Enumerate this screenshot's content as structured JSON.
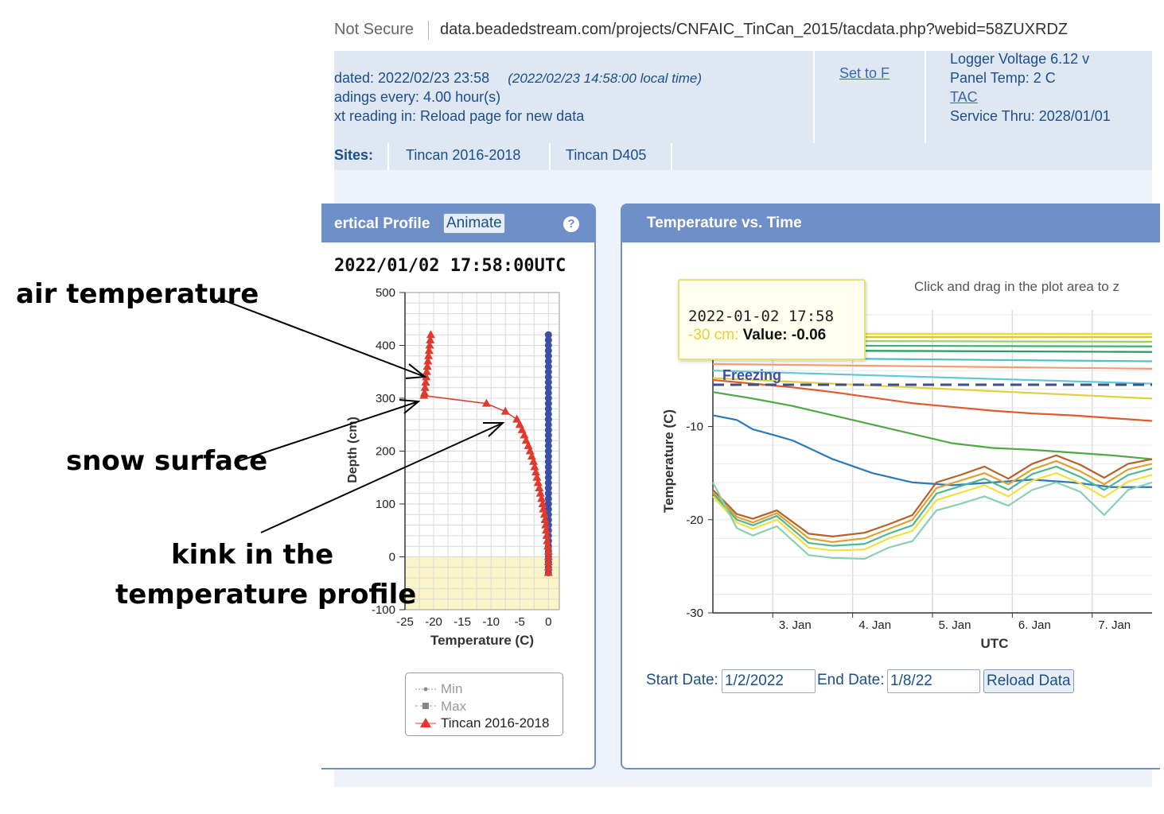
{
  "address_bar": {
    "security": "Not Secure",
    "url": "data.beadedstream.com/projects/CNFAIC_TinCan_2015/tacdata.php?webid=58ZUXRDZ"
  },
  "header": {
    "updated": "dated: 2022/02/23 23:58",
    "local_time": "(2022/02/23 14:58:00 local time)",
    "readings": "adings every: 4.00 hour(s)",
    "next_reading": "xt reading in: Reload page for new data",
    "set_to_f": "Set to F",
    "logger_voltage": "Logger Voltage 6.12 v",
    "panel_temp": "Panel Temp: 2 C",
    "tac_link": "TAC",
    "service_thru": "Service Thru: 2028/01/01"
  },
  "sites": {
    "label": "Sites:",
    "items": [
      "Tincan 2016-2018",
      "Tincan D405"
    ]
  },
  "vertical_profile": {
    "title": "ertical Profile",
    "animate_button": "Animate",
    "help_icon": "?",
    "timestamp": "2022/01/02 17:58:00UTC",
    "legend": [
      "Min",
      "Max",
      "Tincan 2016-2018"
    ]
  },
  "temp_vs_time": {
    "title": "Temperature vs. Time",
    "hint": "Click and drag in the plot area to z",
    "tooltip_date": "2022-01-02 17:58",
    "tooltip_series": "-30 cm:",
    "tooltip_value": "Value: -0.06",
    "freezing_label": "Freezing",
    "start_label": "Start Date:",
    "start_value": "1/2/2022",
    "end_label": "End Date:",
    "end_value": "1/8/22",
    "reload_button": "Reload Data"
  },
  "annotations": {
    "air": "air temperature",
    "snow": "snow surface",
    "kink_line1": "kink in the",
    "kink_line2": "temperature profile"
  },
  "colors": {
    "panel_blue": "#6f8fc8",
    "header_bg": "#dfe7f3",
    "link_blue": "#1a4f8a",
    "profile_red": "#e03a2f",
    "profile_blue": "#3b4fa8",
    "ground_yellow": "#faf5c8"
  },
  "chart_data": [
    {
      "type": "scatter",
      "xlabel": "Temperature (C)",
      "ylabel": "Depth (cm)",
      "xlim": [
        -25,
        0
      ],
      "ylim": [
        -100,
        500
      ],
      "x_ticks": [
        -25,
        -20,
        -15,
        -10,
        -5,
        0
      ],
      "y_ticks": [
        -100,
        0,
        100,
        200,
        300,
        400,
        500
      ],
      "grid": true,
      "legend_position": "bottom",
      "series": [
        {
          "name": "Tincan 2016-2018",
          "points": [
            [
              -20.5,
              420
            ],
            [
              -20.6,
              410
            ],
            [
              -20.7,
              400
            ],
            [
              -20.8,
              390
            ],
            [
              -20.9,
              380
            ],
            [
              -21.0,
              370
            ],
            [
              -21.1,
              360
            ],
            [
              -21.2,
              350
            ],
            [
              -21.3,
              340
            ],
            [
              -21.4,
              330
            ],
            [
              -21.5,
              320
            ],
            [
              -21.6,
              310
            ],
            [
              -21.7,
              305
            ],
            [
              -10.8,
              290
            ],
            [
              -7.5,
              275
            ],
            [
              -5.5,
              260
            ],
            [
              -5.0,
              250
            ],
            [
              -4.6,
              240
            ],
            [
              -4.2,
              230
            ],
            [
              -3.9,
              220
            ],
            [
              -3.5,
              210
            ],
            [
              -3.2,
              200
            ],
            [
              -2.9,
              190
            ],
            [
              -2.6,
              180
            ],
            [
              -2.4,
              170
            ],
            [
              -2.2,
              160
            ],
            [
              -2.0,
              150
            ],
            [
              -1.8,
              140
            ],
            [
              -1.6,
              130
            ],
            [
              -1.4,
              120
            ],
            [
              -1.2,
              110
            ],
            [
              -1.0,
              100
            ],
            [
              -0.9,
              90
            ],
            [
              -0.7,
              80
            ],
            [
              -0.6,
              70
            ],
            [
              -0.5,
              60
            ],
            [
              -0.4,
              50
            ],
            [
              -0.3,
              40
            ],
            [
              -0.2,
              30
            ],
            [
              -0.1,
              20
            ],
            [
              0,
              10
            ],
            [
              0,
              0
            ],
            [
              0,
              -10
            ],
            [
              0,
              -20
            ],
            [
              0,
              -30
            ]
          ]
        },
        {
          "name": "",
          "points": [
            [
              0,
              420
            ],
            [
              0,
              410
            ],
            [
              0,
              400
            ],
            [
              0,
              390
            ],
            [
              0,
              380
            ],
            [
              0,
              370
            ],
            [
              0,
              360
            ],
            [
              0,
              350
            ],
            [
              0,
              340
            ],
            [
              0,
              330
            ],
            [
              0,
              320
            ],
            [
              0,
              310
            ],
            [
              0,
              300
            ],
            [
              0,
              290
            ],
            [
              0,
              280
            ],
            [
              0,
              270
            ],
            [
              0,
              260
            ],
            [
              0,
              250
            ],
            [
              0,
              240
            ],
            [
              0,
              230
            ],
            [
              0,
              220
            ],
            [
              0,
              210
            ],
            [
              0,
              200
            ],
            [
              0,
              190
            ],
            [
              0,
              180
            ],
            [
              0,
              170
            ],
            [
              0,
              160
            ],
            [
              0,
              150
            ],
            [
              0,
              140
            ],
            [
              0,
              130
            ],
            [
              0,
              120
            ],
            [
              0,
              110
            ],
            [
              0,
              100
            ],
            [
              0,
              90
            ],
            [
              0,
              80
            ],
            [
              0,
              70
            ],
            [
              0,
              60
            ],
            [
              0,
              50
            ],
            [
              0,
              40
            ],
            [
              0,
              30
            ],
            [
              0,
              20
            ],
            [
              0,
              10
            ],
            [
              0,
              0
            ],
            [
              0,
              -10
            ],
            [
              0,
              -20
            ],
            [
              0,
              -30
            ]
          ]
        }
      ]
    },
    {
      "type": "line",
      "xlabel": "UTC",
      "ylabel": "Temperature (C)",
      "x_ticks": [
        "3. Jan",
        "4. Jan",
        "5. Jan",
        "6. Jan",
        "7. Jan"
      ],
      "ylim": [
        -30,
        0
      ],
      "y_ticks": [
        -30,
        -20,
        -10,
        0
      ],
      "xlim_days": [
        2.0,
        7.5
      ],
      "series": [
        {
          "color": "#e8e020",
          "x": [
            2.0,
            7.5
          ],
          "values": [
            -0.06,
            -0.06
          ]
        },
        {
          "color": "#f0c020",
          "x": [
            2.0,
            7.5
          ],
          "values": [
            -0.4,
            -0.4
          ]
        },
        {
          "color": "#9fd060",
          "x": [
            2.0,
            7.5
          ],
          "values": [
            -0.8,
            -0.9
          ]
        },
        {
          "color": "#40b070",
          "x": [
            2.0,
            7.5
          ],
          "values": [
            -1.3,
            -1.4
          ]
        },
        {
          "color": "#2a9a60",
          "x": [
            2.0,
            7.5
          ],
          "values": [
            -1.8,
            -2.0
          ]
        },
        {
          "color": "#50c0c0",
          "x": [
            2.0,
            7.5
          ],
          "values": [
            -2.6,
            -3.0
          ]
        },
        {
          "color": "#f0a070",
          "x": [
            2.0,
            7.5
          ],
          "values": [
            -3.3,
            -3.8
          ]
        },
        {
          "color": "#60c8d8",
          "x": [
            2.0,
            7.5
          ],
          "values": [
            -4.0,
            -5.4
          ]
        },
        {
          "color": "#e0d040",
          "x": [
            2.0,
            7.5
          ],
          "values": [
            -4.8,
            -7.0
          ]
        },
        {
          "color": "#e05a30",
          "x": [
            2.0,
            2.5,
            3.0,
            3.5,
            4.0,
            4.5,
            5.0,
            5.5,
            6.0,
            6.5,
            7.0,
            7.5
          ],
          "values": [
            -5.0,
            -5.4,
            -5.8,
            -6.3,
            -6.9,
            -7.5,
            -7.9,
            -8.3,
            -8.6,
            -8.8,
            -9.1,
            -9.4
          ]
        },
        {
          "color": "#50a848",
          "x": [
            2.0,
            2.5,
            3.0,
            3.5,
            4.0,
            4.5,
            5.0,
            5.5,
            6.0,
            6.5,
            7.0,
            7.5
          ],
          "values": [
            -6.3,
            -7.0,
            -7.8,
            -8.8,
            -9.8,
            -10.8,
            -11.8,
            -12.3,
            -12.5,
            -12.8,
            -13.1,
            -13.5
          ]
        },
        {
          "color": "#2a7ab8",
          "x": [
            2.0,
            2.3,
            2.5,
            2.8,
            3.0,
            3.5,
            4.0,
            4.5,
            5.0,
            5.5,
            6.0,
            6.5,
            7.0,
            7.5
          ],
          "values": [
            -8.8,
            -9.3,
            -10.3,
            -11.0,
            -11.5,
            -13.5,
            -15.0,
            -16.0,
            -16.3,
            -16.0,
            -15.7,
            -16.0,
            -16.5,
            -16.5
          ]
        },
        {
          "color": "#b8602a",
          "x": [
            2.0,
            2.3,
            2.5,
            2.8,
            3.2,
            3.5,
            3.9,
            4.2,
            4.5,
            4.8,
            5.1,
            5.4,
            5.7,
            6.0,
            6.3,
            6.6,
            6.9,
            7.2,
            7.5
          ],
          "values": [
            -16.8,
            -19.4,
            -19.9,
            -19.0,
            -21.5,
            -21.8,
            -21.4,
            -20.5,
            -19.5,
            -16.0,
            -15.2,
            -14.3,
            -15.6,
            -14.0,
            -13.1,
            -14.1,
            -15.5,
            -14.0,
            -13.5
          ]
        },
        {
          "color": "#e0a030",
          "x": [
            2.0,
            2.3,
            2.5,
            2.8,
            3.2,
            3.5,
            3.9,
            4.2,
            4.5,
            4.8,
            5.1,
            5.4,
            5.7,
            6.0,
            6.3,
            6.6,
            6.9,
            7.2,
            7.5
          ],
          "values": [
            -17.0,
            -19.7,
            -20.3,
            -19.3,
            -22.0,
            -22.4,
            -22.0,
            -21.0,
            -20.0,
            -16.6,
            -15.8,
            -15.0,
            -16.2,
            -14.6,
            -13.7,
            -14.8,
            -16.2,
            -14.6,
            -14.0
          ]
        },
        {
          "color": "#50b890",
          "x": [
            2.0,
            2.3,
            2.5,
            2.8,
            3.2,
            3.5,
            3.9,
            4.2,
            4.5,
            4.8,
            5.1,
            5.4,
            5.7,
            6.0,
            6.3,
            6.6,
            6.9,
            7.2,
            7.5
          ],
          "values": [
            -17.2,
            -20.0,
            -20.6,
            -19.6,
            -22.5,
            -22.8,
            -22.6,
            -21.5,
            -20.6,
            -17.2,
            -16.4,
            -15.6,
            -16.8,
            -15.1,
            -14.3,
            -15.4,
            -16.8,
            -15.2,
            -14.5
          ]
        },
        {
          "color": "#f0e040",
          "x": [
            2.0,
            2.3,
            2.5,
            2.8,
            3.2,
            3.5,
            3.9,
            4.2,
            4.5,
            4.8,
            5.1,
            5.4,
            5.7,
            6.0,
            6.3,
            6.6,
            6.9,
            7.2,
            7.5
          ],
          "values": [
            -17.5,
            -20.3,
            -21.0,
            -20.0,
            -23.0,
            -23.3,
            -23.2,
            -22.0,
            -21.2,
            -17.9,
            -17.1,
            -16.3,
            -17.5,
            -15.8,
            -15.0,
            -16.1,
            -17.6,
            -15.9,
            -15.2
          ]
        },
        {
          "color": "#8ad0b0",
          "x": [
            2.0,
            2.3,
            2.5,
            2.8,
            3.2,
            3.5,
            3.9,
            4.2,
            4.5,
            4.8,
            5.1,
            5.4,
            5.7,
            6.0,
            6.3,
            6.6,
            6.9,
            7.2,
            7.5
          ],
          "values": [
            -16.0,
            -20.9,
            -21.7,
            -20.7,
            -23.8,
            -24.1,
            -24.2,
            -23.0,
            -22.3,
            -19.0,
            -18.3,
            -17.5,
            -18.5,
            -16.8,
            -16.0,
            -17.0,
            -19.5,
            -16.8,
            -16.0
          ]
        }
      ]
    }
  ]
}
